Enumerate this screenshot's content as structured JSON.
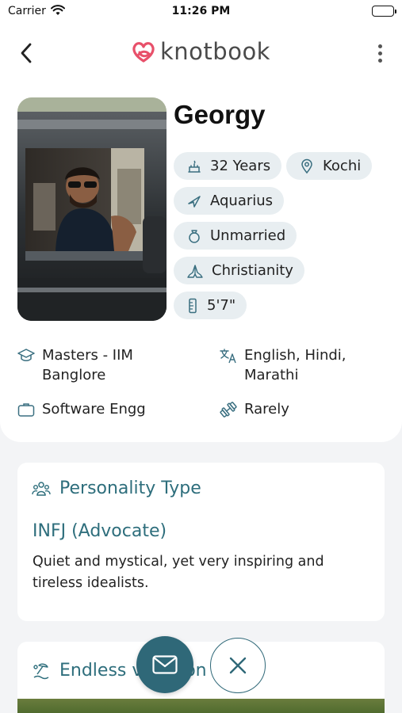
{
  "status_bar": {
    "carrier": "Carrier",
    "time": "11:26 PM"
  },
  "header": {
    "logo_text": "knotbook",
    "back_icon": "chevron-left-icon",
    "menu_icon": "more-vertical-icon",
    "brand_color": "#e8506a"
  },
  "profile": {
    "name": "Georgy",
    "chips": {
      "age": "32 Years",
      "location": "Kochi",
      "zodiac": "Aquarius",
      "marital_status": "Unmarried",
      "religion": "Christianity",
      "height": "5'7\""
    },
    "facts": {
      "education_line1": "Masters - IIM",
      "education_line2": "Banglore",
      "languages_line1": "English, Hindi,",
      "languages_line2": "Marathi",
      "profession": "Software Engg",
      "fitness": "Rarely"
    }
  },
  "personality": {
    "title": "Personality Type",
    "type": "INFJ (Advocate)",
    "description": "Quiet and mystical, yet very inspiring and tireless idealists."
  },
  "interest": {
    "title": "Endless vacation"
  },
  "actions": {
    "message_icon": "mail-icon",
    "close_icon": "close-icon"
  },
  "colors": {
    "accent": "#2f6878",
    "chip_bg": "#e8eef1",
    "heading": "#2e6e7c"
  }
}
